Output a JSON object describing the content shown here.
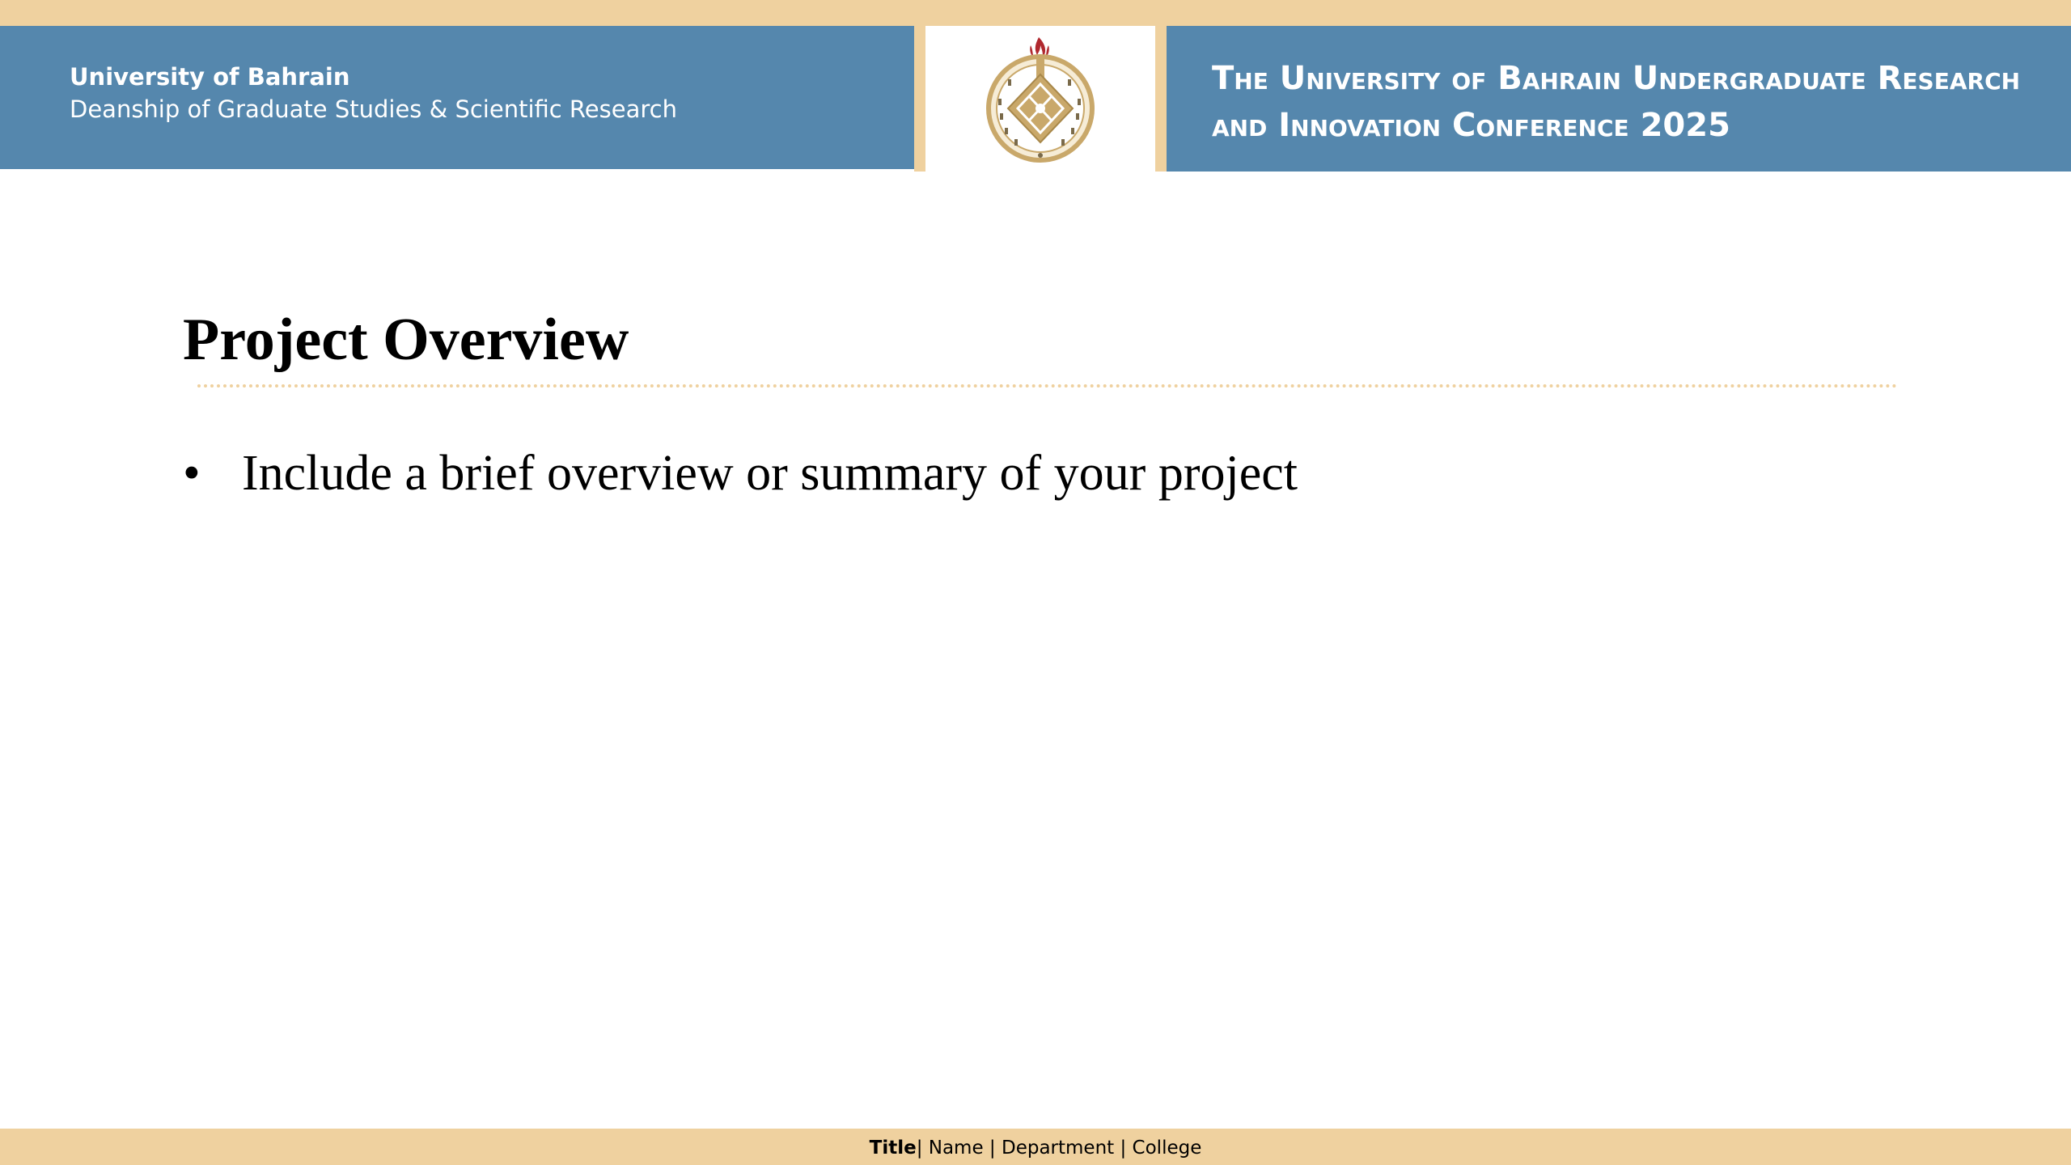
{
  "header": {
    "university": "University of Bahrain",
    "deanship": "Deanship of Graduate Studies & Scientific Research",
    "conference_line1": "The University of Bahrain Undergraduate Research",
    "conference_line2": "and Innovation Conference 2025",
    "logo_icon": "university-seal-icon"
  },
  "slide": {
    "title": "Project Overview",
    "bullet_mark": "•",
    "bullets": [
      "Include a brief overview or summary of your project"
    ]
  },
  "footer": {
    "title": "Title",
    "separator_1": "| ",
    "name": "Name",
    "separator_2": " | ",
    "department": "Department",
    "separator_3": " | ",
    "college": "College"
  },
  "colors": {
    "header_blue": "#5587ad",
    "accent_gold": "#efd19f",
    "seal_gold": "#c9a86a",
    "seal_red": "#b0282e"
  }
}
